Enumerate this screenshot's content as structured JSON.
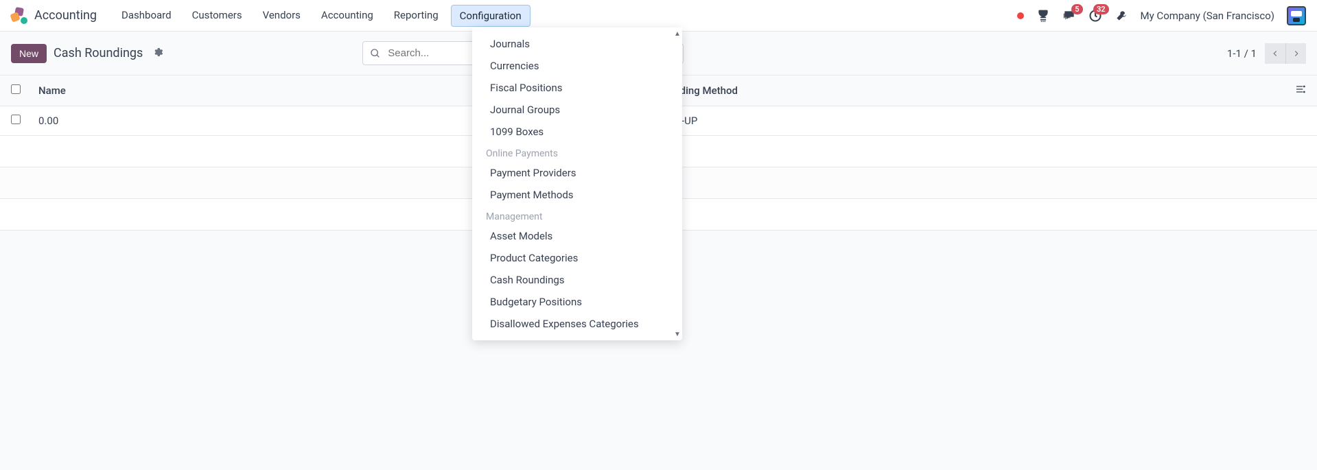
{
  "app_name": "Accounting",
  "nav": {
    "items": [
      "Dashboard",
      "Customers",
      "Vendors",
      "Accounting",
      "Reporting",
      "Configuration"
    ],
    "active_index": 5
  },
  "badges": {
    "messages": "5",
    "activities": "32"
  },
  "company": "My Company (San Francisco)",
  "control": {
    "new_label": "New",
    "breadcrumb": "Cash Roundings",
    "search_placeholder": "Search..."
  },
  "pager": {
    "text": "1-1 / 1"
  },
  "table": {
    "columns": {
      "name": "Name",
      "method": "Rounding Method"
    },
    "rows": [
      {
        "name": "0.00",
        "method": "HALF-UP"
      }
    ]
  },
  "dropdown": {
    "section1_items": [
      "Journals",
      "Currencies",
      "Fiscal Positions",
      "Journal Groups",
      "1099 Boxes"
    ],
    "section2_header": "Online Payments",
    "section2_items": [
      "Payment Providers",
      "Payment Methods"
    ],
    "section3_header": "Management",
    "section3_items": [
      "Asset Models",
      "Product Categories",
      "Cash Roundings",
      "Budgetary Positions",
      "Disallowed Expenses Categories"
    ]
  }
}
